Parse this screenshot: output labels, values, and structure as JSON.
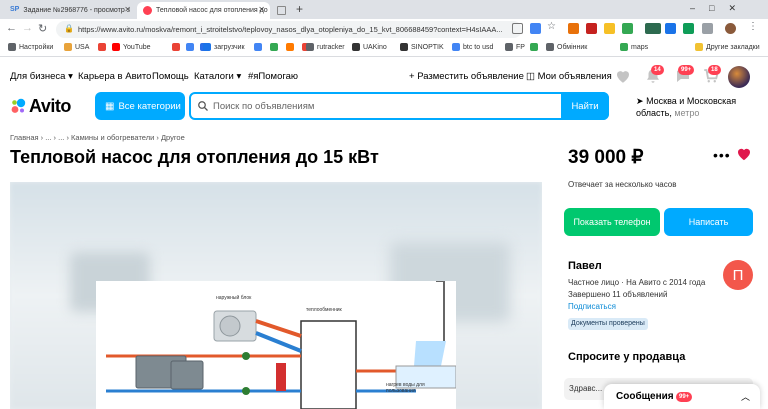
{
  "browser": {
    "tabs": [
      {
        "label": "Задание №2968776 - просмотр з",
        "favicon": "sp-logo-icon"
      },
      {
        "label": "Тепловой насос для отопления до",
        "favicon": "avito-favicon-icon"
      },
      {
        "label": "",
        "favicon": "blank-page-icon"
      }
    ],
    "new_tab": "+",
    "url": "https://www.avito.ru/moskva/remont_i_stroitelstvo/teplovoy_nasos_dlya_otopleniya_do_15_kvt_806688459?context=H4sIAAA..."
  },
  "bookmarks": [
    {
      "label": "Настройки",
      "color": "#5f6368"
    },
    {
      "label": "USA",
      "color": "#e8a33b"
    },
    {
      "label": "",
      "color": "#ea4335"
    },
    {
      "label": "YouTube",
      "color": "#ff0000"
    },
    {
      "label": "",
      "color": "#ea4335"
    },
    {
      "label": "",
      "color": "#4285f4"
    },
    {
      "label": "",
      "color": "#2a6ee8"
    },
    {
      "label": "загрузчик",
      "color": "#1a73e8"
    },
    {
      "label": "",
      "color": "#4285f4"
    },
    {
      "label": "",
      "color": "#34a853"
    },
    {
      "label": "",
      "color": "#ff7a00"
    },
    {
      "label": "",
      "color": "#ea4335"
    },
    {
      "label": "rutracker",
      "color": "#5f6368"
    },
    {
      "label": "UAKino",
      "color": "#333333"
    },
    {
      "label": "SINOPTIK",
      "color": "#333333"
    },
    {
      "label": "btc to usd",
      "color": "#4285f4"
    },
    {
      "label": "FP",
      "color": "#5f6368"
    },
    {
      "label": "",
      "color": "#34a853"
    },
    {
      "label": "Обмінник",
      "color": "#5f6368"
    },
    {
      "label": "maps",
      "color": "#34a853"
    },
    {
      "label": "Другие закладки",
      "color": "#f1c232"
    }
  ],
  "header": {
    "for_business": "Для бизнеса",
    "career": "Карьера в Авито",
    "help": "Помощь",
    "catalogs": "Каталоги",
    "help_tag": "#яПомогаю",
    "post_ad": "Разместить объявление",
    "my_ads": "Мои объявления",
    "notifications_count": "14",
    "messages_count": "99+",
    "cart_count": "18"
  },
  "logo": "Avito",
  "search": {
    "categories_label": "Все категории",
    "placeholder": "Поиск по объявлениям",
    "button_label": "Найти",
    "region": "Москва и Московская область,",
    "region_suffix": "метро"
  },
  "listing": {
    "breadcrumb": "Главная › ... › ... › Камины и обогреватели › Другое",
    "title": "Тепловой насос для отопления до 15 кВт",
    "price": "39 000 ₽",
    "reply_time": "Отвечает за несколько часов",
    "phone_button": "Показать телефон",
    "write_button": "Написать",
    "diagram_labels": {
      "outdoor_unit": "наружный блок",
      "heat_exchanger": "теплообменник",
      "water_heating": "нагрев воды для пользования"
    }
  },
  "seller": {
    "name": "Павел",
    "avatar_letter": "П",
    "info": "Частное лицо · На Авито с 2014 года",
    "completed": "Завершено 11 объявлений",
    "subscribe": "Подписаться",
    "docs_badge": "Документы проверены"
  },
  "ask": {
    "title": "Спросите у продавца",
    "input_text": "Здравс..."
  },
  "messenger": {
    "label": "Сообщения",
    "count": "99+"
  }
}
